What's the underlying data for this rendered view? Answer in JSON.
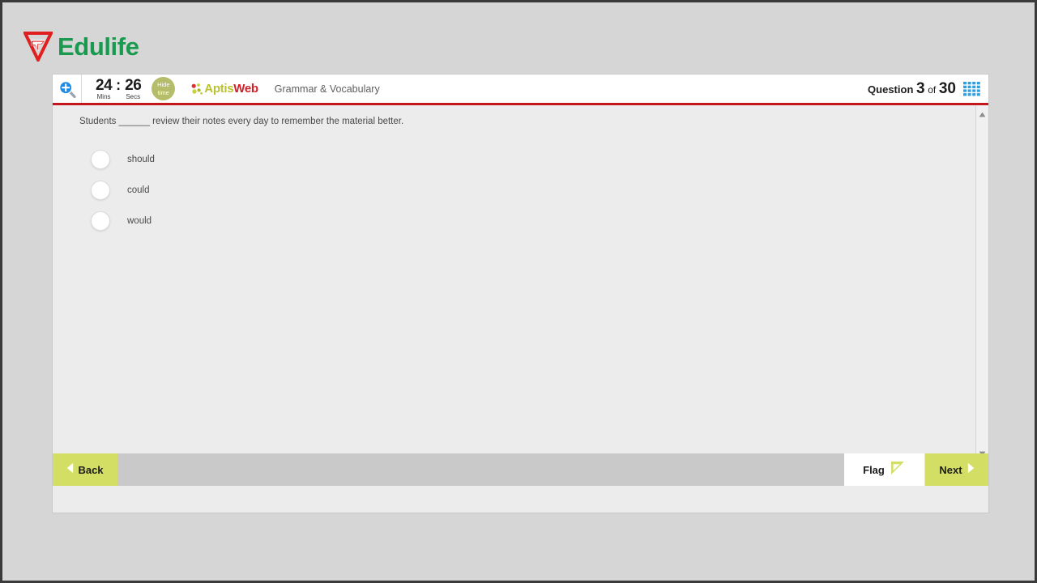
{
  "brand": {
    "name": "Edulife",
    "mark_icon": "edulife-triangle-logo",
    "mark_color": "#e02020",
    "name_color": "#1a9a4f"
  },
  "topbar": {
    "zoom_icon": "zoom-in-magnifier-icon",
    "timer": {
      "minutes": "24",
      "separator": ":",
      "seconds": "26",
      "minutes_label": "Mins",
      "seconds_label": "Secs"
    },
    "hide_time": {
      "line1": "Hide",
      "line2": "time",
      "color": "#b5bc6a"
    },
    "aptis_logo": {
      "dots_icon": "aptis-dots-icon",
      "part1": "Aptis",
      "part2": "Web",
      "part1_color": "#b9c232",
      "part2_color": "#d12026"
    },
    "section_label": "Grammar & Vocabulary",
    "question_counter": {
      "prefix": "Question",
      "current": "3",
      "of": "of",
      "total": "30"
    },
    "grid_icon": "question-grid-icon",
    "accent_bar_color": "#c4161c"
  },
  "question": {
    "text": "Students ______ review their notes every day to remember the material better.",
    "options": [
      {
        "label": "should",
        "selected": false
      },
      {
        "label": "could",
        "selected": false
      },
      {
        "label": "would",
        "selected": false
      }
    ]
  },
  "scrollbar": {
    "up_icon": "scroll-up-arrow-icon",
    "down_icon": "scroll-down-arrow-icon"
  },
  "nav": {
    "back_label": "Back",
    "back_icon": "left-triangle-icon",
    "flag_label": "Flag",
    "flag_icon": "flag-pennant-icon",
    "next_label": "Next",
    "next_icon": "right-triangle-icon",
    "button_color": "#d3de65"
  }
}
